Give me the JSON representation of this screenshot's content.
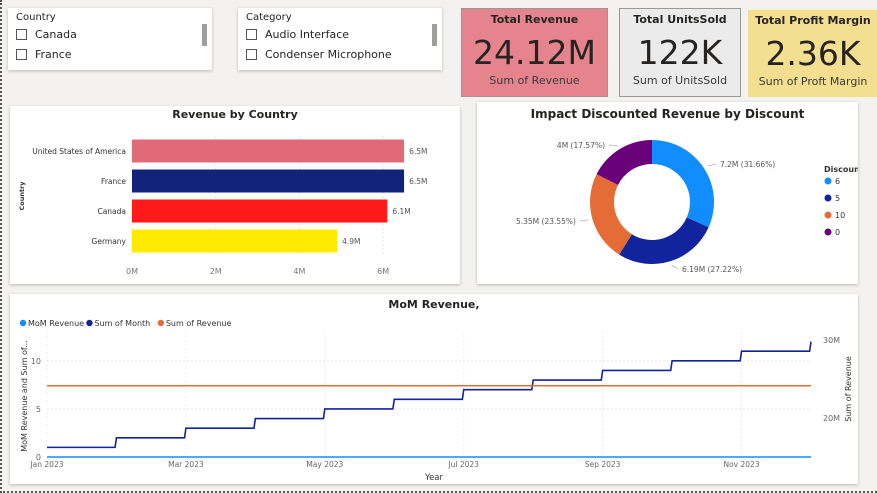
{
  "slicers": {
    "country": {
      "title": "Country",
      "items": [
        "Canada",
        "France"
      ]
    },
    "category": {
      "title": "Category",
      "items": [
        "Audio Interface",
        "Condenser Microphone"
      ]
    }
  },
  "kpis": [
    {
      "title": "Total Revenue",
      "value": "24.12M",
      "sub": "Sum of Revenue",
      "bg": "#e5848c"
    },
    {
      "title": "Total UnitsSold",
      "value": "122K",
      "sub": "Sum of UnitsSold",
      "bg": "#ebebeb"
    },
    {
      "title": "Total Profit Margin",
      "value": "2.36K",
      "sub": "Sum of Proft Margin",
      "bg": "#f3df8f"
    }
  ],
  "revenue_by_country": {
    "title": "Revenue by Country",
    "ylabel": "Country",
    "tick_labels": [
      "0M",
      "2M",
      "4M",
      "6M"
    ]
  },
  "donut": {
    "title": "Impact Discounted Revenue by Discount",
    "legend_title": "Discount"
  },
  "mom": {
    "title": "MoM Revenue,",
    "legend": [
      "MoM Revenue",
      "Sum of Month",
      "Sum of Revenue"
    ],
    "xlabel": "Year",
    "ylabel_left": "MoM Revenue and Sum of...",
    "ylabel_right": "Sum of Revenue",
    "left_ticks": [
      "0",
      "5",
      "10"
    ],
    "right_ticks": [
      "20M",
      "30M"
    ],
    "x_ticks": [
      "Jan 2023",
      "Mar 2023",
      "May 2023",
      "Jul 2023",
      "Sep 2023",
      "Nov 2023"
    ]
  },
  "chart_data": [
    {
      "type": "bar",
      "title": "Revenue by Country",
      "categories": [
        "United States of America",
        "France",
        "Canada",
        "Germany"
      ],
      "values": [
        6.5,
        6.5,
        6.1,
        4.9
      ],
      "data_labels": [
        "6.5M",
        "6.5M",
        "6.1M",
        "4.9M"
      ],
      "unit": "M",
      "xlim": [
        0,
        7
      ],
      "colors": [
        "#e06a78",
        "#12237c",
        "#ff1a1a",
        "#ffea00"
      ],
      "ylabel": "Country",
      "grid": true
    },
    {
      "type": "pie",
      "title": "Impact Discounted Revenue by Discount",
      "categories": [
        "6",
        "5",
        "10",
        "0"
      ],
      "values": [
        7.2,
        6.19,
        5.35,
        4.0
      ],
      "percentages": [
        31.66,
        27.22,
        23.55,
        17.57
      ],
      "labels": [
        "7.2M (31.66%)",
        "6.19M (27.22%)",
        "5.35M (23.55%)",
        "4M (17.57%)"
      ],
      "colors": [
        "#118dff",
        "#12239e",
        "#e66c37",
        "#6b007b"
      ],
      "legend": "right"
    },
    {
      "type": "line",
      "title": "MoM Revenue,",
      "x": [
        "Jan 2023",
        "Feb 2023",
        "Mar 2023",
        "Apr 2023",
        "May 2023",
        "Jun 2023",
        "Jul 2023",
        "Aug 2023",
        "Sep 2023",
        "Oct 2023",
        "Nov 2023",
        "Dec 2023"
      ],
      "series": [
        {
          "name": "MoM Revenue",
          "values": [
            0,
            0,
            0,
            0,
            0,
            0,
            0,
            0,
            0,
            0,
            0,
            0
          ],
          "color": "#118dff",
          "axis": "left"
        },
        {
          "name": "Sum of Month",
          "values": [
            1,
            2,
            3,
            4,
            5,
            6,
            7,
            8,
            9,
            10,
            11,
            12
          ],
          "color": "#12239e",
          "axis": "left"
        },
        {
          "name": "Sum of Revenue",
          "values": [
            24.12,
            24.12,
            24.12,
            24.12,
            24.12,
            24.12,
            24.12,
            24.12,
            24.12,
            24.12,
            24.12,
            24.12
          ],
          "color": "#e66c37",
          "axis": "right"
        }
      ],
      "ylim_left": [
        0,
        13
      ],
      "ylim_right": [
        15,
        31
      ],
      "xlabel": "Year",
      "legend": "top-left",
      "grid": true
    }
  ]
}
